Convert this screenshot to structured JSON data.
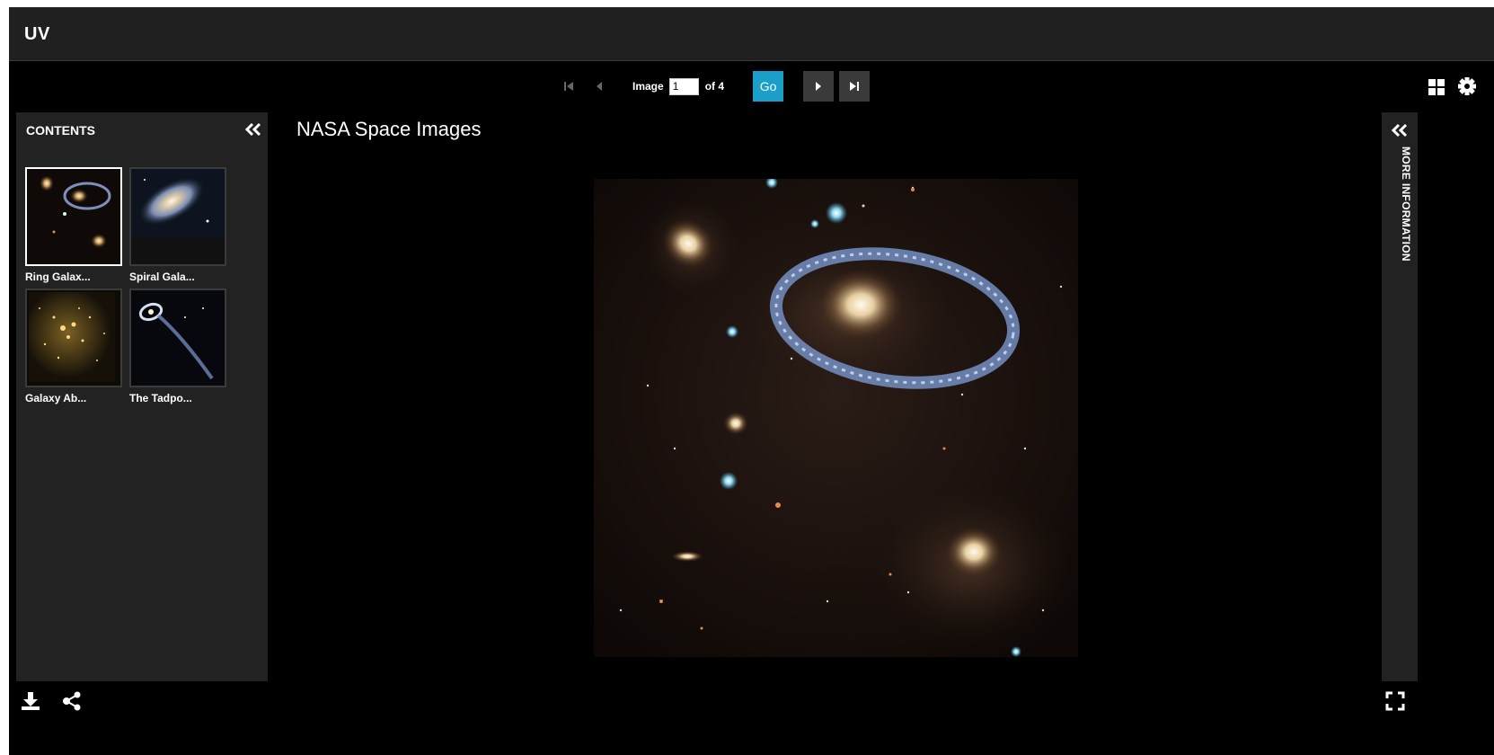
{
  "app": {
    "title": "UV"
  },
  "toolbar": {
    "image_label": "Image",
    "page_value": "1",
    "of_label": "of 4",
    "go_label": "Go"
  },
  "contents": {
    "title": "CONTENTS",
    "thumbnails": [
      {
        "label": "Ring Galax...",
        "selected": true
      },
      {
        "label": "Spiral Gala...",
        "selected": false
      },
      {
        "label": "Galaxy Ab...",
        "selected": false
      },
      {
        "label": "The Tadpo...",
        "selected": false
      }
    ]
  },
  "main": {
    "title": "NASA Space Images"
  },
  "right_panel": {
    "label": "MORE INFORMATION"
  },
  "icons": [
    "first-page-icon",
    "previous-page-icon",
    "next-page-icon",
    "last-page-icon",
    "grid-view-icon",
    "gear-icon",
    "collapse-left-icon",
    "collapse-right-icon",
    "download-icon",
    "share-icon",
    "fullscreen-icon"
  ],
  "colors": {
    "accent": "#1a9fc9",
    "panel": "#222222",
    "header": "#202020",
    "background": "#000000"
  }
}
